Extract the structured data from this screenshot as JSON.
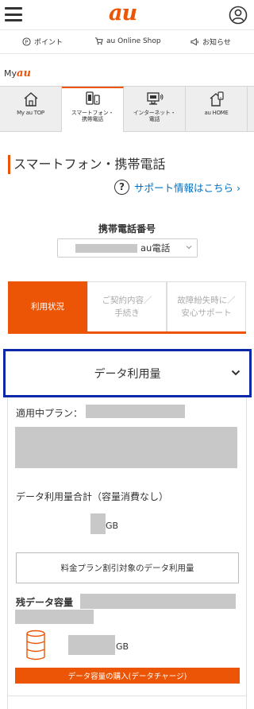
{
  "header": {
    "logo": "au"
  },
  "subnav": {
    "points": "ポイント",
    "shop": "au Online Shop",
    "notices": "お知らせ"
  },
  "myau": {
    "prefix": "My",
    "brand": "au"
  },
  "category_tabs": [
    {
      "label": "My au TOP",
      "icon": "home-icon",
      "active": false
    },
    {
      "label": "スマートフォン・\n携帯電話",
      "icon": "smartphone-icon",
      "active": true
    },
    {
      "label": "インターネット・\n電話",
      "icon": "internet-icon",
      "active": false
    },
    {
      "label": "au HOME",
      "icon": "au-home-icon",
      "active": false
    }
  ],
  "page": {
    "title": "スマートフォン・携帯電話",
    "support_link": "サポート情報はこちら ›",
    "support_icon": "?"
  },
  "phone": {
    "label": "携帯電話番号",
    "selected_suffix": "au電話"
  },
  "usage_tabs": [
    {
      "label": "利用状況",
      "active": true
    },
    {
      "label": "ご契約内容／\n手続き",
      "active": false
    },
    {
      "label": "故障紛失時に／\n安心サポート",
      "active": false
    }
  ],
  "data_usage": {
    "accordion_title": "データ利用量",
    "plan_label": "適用中プラン：",
    "total_label": "データ利用量合計（容量消費なし）",
    "total_unit": "GB",
    "discount_button": "料金プラン割引対象のデータ利用量",
    "remaining_label": "残データ容量",
    "remaining_unit": "GB",
    "charge_button": "データ容量の購入(データチャージ)"
  },
  "colors": {
    "brand": "#eb5505",
    "link": "#0070c0",
    "highlight_border": "#0a28a8",
    "masked": "#c8c8c8"
  }
}
